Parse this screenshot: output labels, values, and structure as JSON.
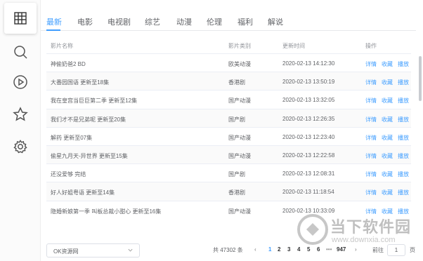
{
  "tabs": [
    {
      "label": "最新"
    },
    {
      "label": "电影"
    },
    {
      "label": "电视剧"
    },
    {
      "label": "综艺"
    },
    {
      "label": "动漫"
    },
    {
      "label": "伦理"
    },
    {
      "label": "福利"
    },
    {
      "label": "解说"
    }
  ],
  "active_tab": "最新",
  "sidebar": {
    "icons": [
      "grid-icon",
      "search-icon",
      "play-icon",
      "star-icon",
      "gear-icon"
    ]
  },
  "table": {
    "headers": {
      "name": "影片名称",
      "type": "影片类别",
      "time": "更新时间",
      "actions": "操作"
    },
    "action_labels": {
      "detail": "详情",
      "collect": "收藏",
      "play": "播放"
    },
    "rows": [
      {
        "name": "神偷奶爸2 BD",
        "type": "欧美动漫",
        "time": "2020-02-13 14:12:30"
      },
      {
        "name": "大番园国语 更新至18集",
        "type": "香港剧",
        "time": "2020-02-13 13:50:19"
      },
      {
        "name": "我在皇宫当巨巨第二季 更新至12集",
        "type": "国产动漫",
        "time": "2020-02-13 13:32:05"
      },
      {
        "name": "我们才不是兄弟呢 更新至20集",
        "type": "国产剧",
        "time": "2020-02-13 12:26:35"
      },
      {
        "name": "解药 更新至07集",
        "type": "国产动漫",
        "time": "2020-02-13 12:23:40"
      },
      {
        "name": "偷星九月天-异世界 更新至15集",
        "type": "国产动漫",
        "time": "2020-02-13 12:22:58"
      },
      {
        "name": "还没爱够 完结",
        "type": "国产剧",
        "time": "2020-02-13 12:08:31"
      },
      {
        "name": "好人好姐粤语 更新至14集",
        "type": "香港剧",
        "time": "2020-02-13 11:18:54"
      },
      {
        "name": "隐婚新娘第一季 叫板总裁小甜心 更新至16集",
        "type": "国产动漫",
        "time": "2020-02-13 10:33:09"
      }
    ]
  },
  "footer": {
    "source": "OK资源网",
    "total": "共 47302 条",
    "pages": [
      "1",
      "2",
      "3",
      "4",
      "5",
      "6"
    ],
    "ellipsis": "•••",
    "last_page": "947",
    "goto_label": "前往",
    "goto_value": "1",
    "page_suffix": "页",
    "prev": "‹",
    "next": "›"
  },
  "watermark": {
    "title": "当下软件园",
    "url": "www.downxia.com"
  },
  "colors": {
    "accent": "#409eff",
    "text": "#606266",
    "header": "#909399",
    "border": "#ebeef5"
  }
}
